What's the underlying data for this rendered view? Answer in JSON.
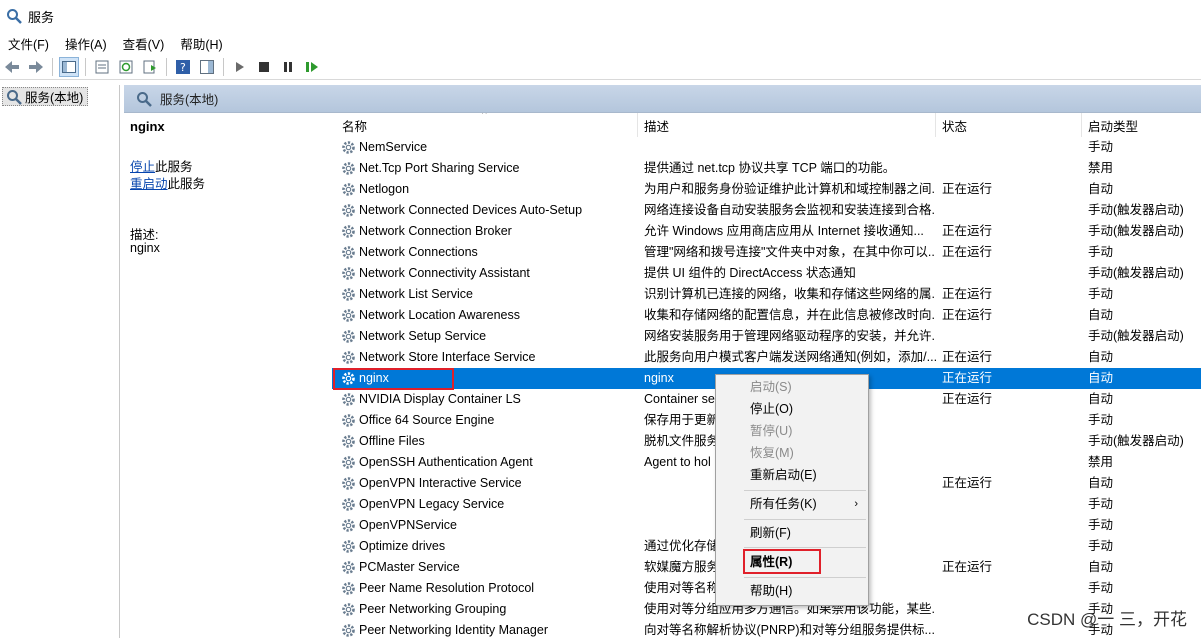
{
  "window": {
    "title": "服务"
  },
  "menu": [
    "文件(F)",
    "操作(A)",
    "查看(V)",
    "帮助(H)"
  ],
  "toolbar": {
    "icons": [
      "back-arrow-icon",
      "forward-arrow-icon",
      "show-hide-console-tree-icon",
      "properties-icon",
      "refresh-icon",
      "export-list-icon",
      "help-icon",
      "show-action-pane-icon",
      "start-service-icon",
      "stop-service-icon",
      "pause-service-icon",
      "restart-service-icon"
    ]
  },
  "tree": {
    "item": "服务(本地)"
  },
  "main": {
    "header": "服务(本地)"
  },
  "detail": {
    "title": "nginx",
    "stop_link": "停止",
    "stop_suffix": "此服务",
    "restart_link": "重启动",
    "restart_suffix": "此服务",
    "desc_label": "描述:",
    "desc": "nginx"
  },
  "columns": {
    "name": "名称",
    "desc": "描述",
    "status": "状态",
    "start": "启动类型"
  },
  "rows": [
    {
      "name": "NemService",
      "desc": "",
      "status": "",
      "start": "手动"
    },
    {
      "name": "Net.Tcp Port Sharing Service",
      "desc": "提供通过 net.tcp 协议共享 TCP 端口的功能。",
      "status": "",
      "start": "禁用"
    },
    {
      "name": "Netlogon",
      "desc": "为用户和服务身份验证维护此计算机和域控制器之间...",
      "status": "正在运行",
      "start": "自动"
    },
    {
      "name": "Network Connected Devices Auto-Setup",
      "desc": "网络连接设备自动安装服务会监视和安装连接到合格...",
      "status": "",
      "start": "手动(触发器启动)"
    },
    {
      "name": "Network Connection Broker",
      "desc": "允许 Windows 应用商店应用从 Internet 接收通知...",
      "status": "正在运行",
      "start": "手动(触发器启动)"
    },
    {
      "name": "Network Connections",
      "desc": "管理\"网络和拨号连接\"文件夹中对象，在其中你可以...",
      "status": "正在运行",
      "start": "手动"
    },
    {
      "name": "Network Connectivity Assistant",
      "desc": "提供 UI 组件的 DirectAccess 状态通知",
      "status": "",
      "start": "手动(触发器启动)"
    },
    {
      "name": "Network List Service",
      "desc": "识别计算机已连接的网络，收集和存储这些网络的属...",
      "status": "正在运行",
      "start": "手动"
    },
    {
      "name": "Network Location Awareness",
      "desc": "收集和存储网络的配置信息，并在此信息被修改时向...",
      "status": "正在运行",
      "start": "自动"
    },
    {
      "name": "Network Setup Service",
      "desc": "网络安装服务用于管理网络驱动程序的安装，并允许...",
      "status": "",
      "start": "手动(触发器启动)"
    },
    {
      "name": "Network Store Interface Service",
      "desc": "此服务向用户模式客户端发送网络通知(例如，添加/...",
      "status": "正在运行",
      "start": "自动"
    },
    {
      "name": "nginx",
      "desc": "nginx",
      "status": "正在运行",
      "start": "自动",
      "selected": true
    },
    {
      "name": "NVIDIA Display Container LS",
      "desc": "Container se                                    ures",
      "status": "正在运行",
      "start": "自动"
    },
    {
      "name": "Office 64 Source Engine",
      "desc": "保存用于更新                                   载安装程...",
      "status": "",
      "start": "手动"
    },
    {
      "name": "Offline Files",
      "desc": "脱机文件服务                                   动，响应...",
      "status": "",
      "start": "手动(触发器启动)"
    },
    {
      "name": "OpenSSH Authentication Agent",
      "desc": "Agent to hol                                   blic key ...",
      "status": "",
      "start": "禁用"
    },
    {
      "name": "OpenVPN Interactive Service",
      "desc": "",
      "status": "正在运行",
      "start": "自动"
    },
    {
      "name": "OpenVPN Legacy Service",
      "desc": "",
      "status": "",
      "start": "手动"
    },
    {
      "name": "OpenVPNService",
      "desc": "",
      "status": "",
      "start": "手动"
    },
    {
      "name": "Optimize drives",
      "desc": "通过优化存储                                   更高效地...",
      "status": "",
      "start": "手动"
    },
    {
      "name": "PCMaster Service",
      "desc": "软媒魔方服务                                   的分析，",
      "status": "正在运行",
      "start": "自动"
    },
    {
      "name": "Peer Name Resolution Protocol",
      "desc": "使用对等名称                                   上启用无...",
      "status": "",
      "start": "手动"
    },
    {
      "name": "Peer Networking Grouping",
      "desc": "使用对等分组应用多方通信。如果禁用该功能，某些...",
      "status": "",
      "start": "手动"
    },
    {
      "name": "Peer Networking Identity Manager",
      "desc": "向对等名称解析协议(PNRP)和对等分组服务提供标...",
      "status": "",
      "start": "手动"
    }
  ],
  "context_menu": [
    {
      "label": "启动(S)",
      "disabled": true
    },
    {
      "label": "停止(O)",
      "disabled": false
    },
    {
      "label": "暂停(U)",
      "disabled": true
    },
    {
      "label": "恢复(M)",
      "disabled": true
    },
    {
      "label": "重新启动(E)",
      "disabled": false
    },
    {
      "label": "所有任务(K)",
      "disabled": false,
      "submenu": true
    },
    {
      "label": "刷新(F)",
      "disabled": false
    },
    {
      "label": "属性(R)",
      "disabled": false,
      "bold": true
    },
    {
      "label": "帮助(H)",
      "disabled": false
    }
  ],
  "watermark": "CSDN @一 三，开花",
  "colors": {
    "selection": "#0078d7",
    "highlight_box": "#e0202a"
  }
}
